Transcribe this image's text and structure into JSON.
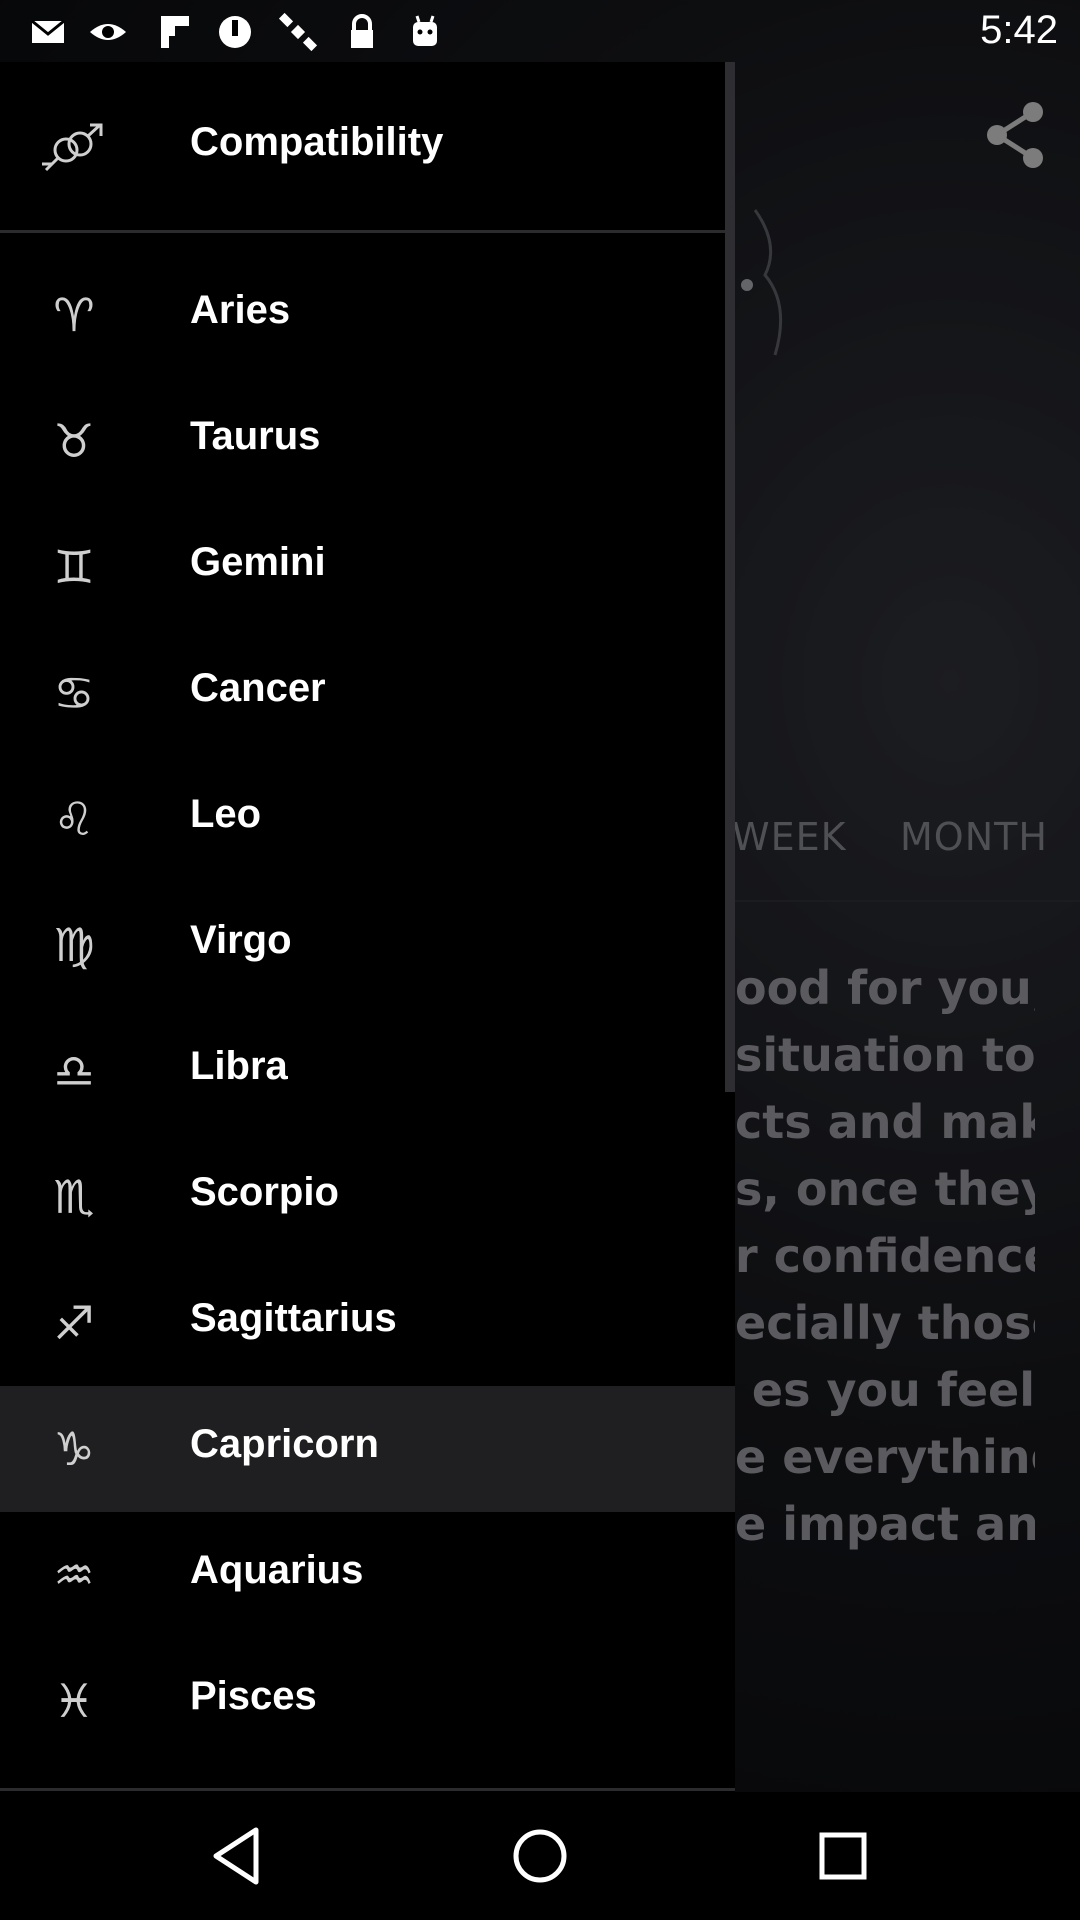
{
  "status_bar": {
    "time": "5:42",
    "icons": [
      "mail-icon",
      "eye-icon",
      "flipboard-icon",
      "dnd-icon",
      "satellite-icon",
      "lock-icon",
      "android-icon"
    ]
  },
  "drawer": {
    "header": {
      "label": "Compatibility",
      "icon": "compatibility-icon"
    },
    "items": [
      {
        "label": "Aries",
        "glyph": "♈"
      },
      {
        "label": "Taurus",
        "glyph": "♉"
      },
      {
        "label": "Gemini",
        "glyph": "♊"
      },
      {
        "label": "Cancer",
        "glyph": "♋"
      },
      {
        "label": "Leo",
        "glyph": "♌"
      },
      {
        "label": "Virgo",
        "glyph": "♍"
      },
      {
        "label": "Libra",
        "glyph": "♎"
      },
      {
        "label": "Scorpio",
        "glyph": "♏"
      },
      {
        "label": "Sagittarius",
        "glyph": "♐"
      },
      {
        "label": "Capricorn",
        "glyph": "♑",
        "selected": true
      },
      {
        "label": "Aquarius",
        "glyph": "♒"
      },
      {
        "label": "Pisces",
        "glyph": "♓"
      }
    ]
  },
  "background": {
    "tabs": [
      "WEEK",
      "MONTH"
    ],
    "text_lines": [
      "ood for you,",
      "situation  to",
      "cts and make",
      "s, once they",
      "r  confidence",
      "ecially  those",
      "es  you  feel",
      "e everything",
      "e impact and"
    ]
  },
  "colors": {
    "selected_bg": "#1f1f21",
    "drawer_bg": "#000000",
    "text_dim": "#8c8d92"
  }
}
